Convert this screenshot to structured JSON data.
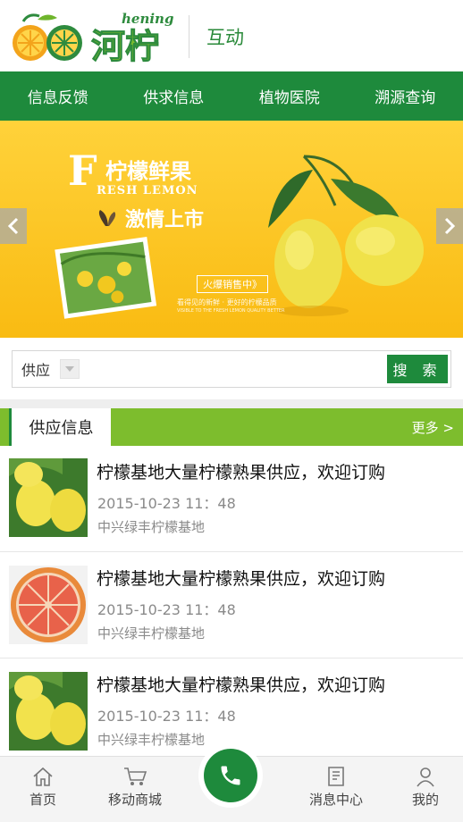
{
  "header": {
    "brand_en": "hening",
    "brand_cn": "河柠",
    "title": "互动"
  },
  "nav": [
    {
      "label": "信息反馈"
    },
    {
      "label": "供求信息"
    },
    {
      "label": "植物医院"
    },
    {
      "label": "溯源查询"
    }
  ],
  "banner": {
    "letter": "F",
    "title": "柠檬鲜果",
    "subtitle_en": "RESH LEMON",
    "slogan": "激情上市",
    "badge": "火爆销售中》",
    "small_cn": "看得见的新鲜 · 更好的柠檬品质",
    "small_en": "VISIBLE TO THE FRESH LEMON QUALITY BETTER"
  },
  "search": {
    "type_value": "供应",
    "input_value": "",
    "button_label": "搜 索"
  },
  "supply": {
    "heading": "供应信息",
    "more_label": "更多 >",
    "items": [
      {
        "title": "柠檬基地大量柠檬熟果供应，欢迎订购",
        "date": "2015-10-23 11：48",
        "source": "中兴绿丰柠檬基地",
        "image": "lemons-image"
      },
      {
        "title": "柠檬基地大量柠檬熟果供应，欢迎订购",
        "date": "2015-10-23 11：48",
        "source": "中兴绿丰柠檬基地",
        "image": "grapefruit-image"
      },
      {
        "title": "柠檬基地大量柠檬熟果供应，欢迎订购",
        "date": "2015-10-23 11：48",
        "source": "中兴绿丰柠檬基地",
        "image": "lemons-image"
      }
    ]
  },
  "tabbar": {
    "home": "首页",
    "mall": "移动商城",
    "messages": "消息中心",
    "mine": "我的"
  },
  "colors": {
    "primary": "#1e8a3c",
    "accent": "#7dbd2d",
    "banner": "#f9bb12"
  }
}
